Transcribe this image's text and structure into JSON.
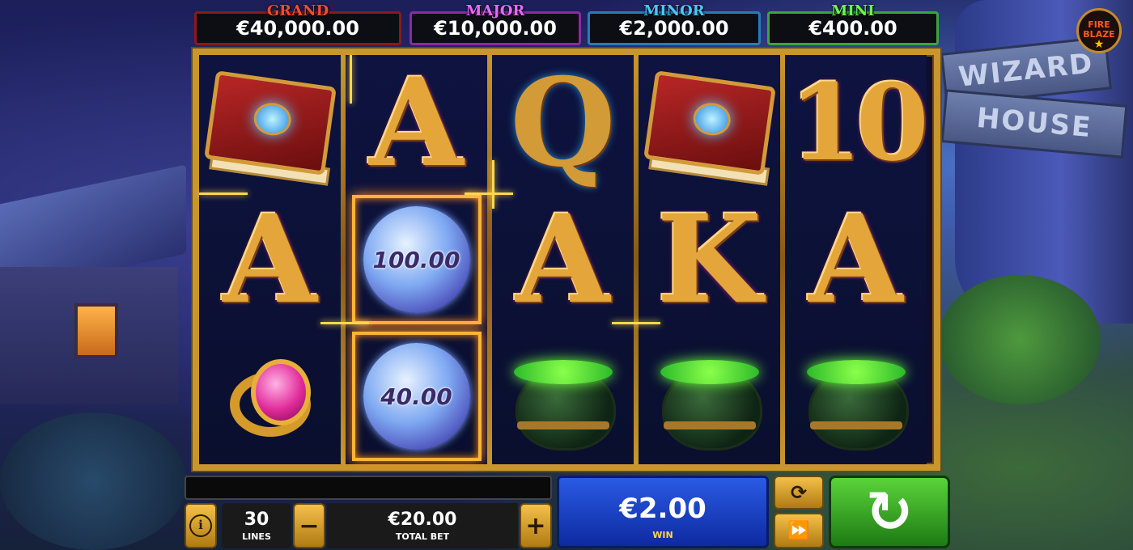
{
  "jackpots": {
    "grand": {
      "title": "GRAND",
      "value": "€40,000.00"
    },
    "major": {
      "title": "MAJOR",
      "value": "€10,000.00"
    },
    "minor": {
      "title": "MINOR",
      "value": "€2,000.00"
    },
    "mini": {
      "title": "MINI",
      "value": "€400.00"
    }
  },
  "logo": {
    "line1": "FIRE",
    "line2": "BLAZE"
  },
  "scenery": {
    "sign_top": "WIZARD",
    "sign_bottom": "HOUSE"
  },
  "reels": [
    [
      {
        "symbol": "spell-book"
      },
      {
        "symbol": "letter",
        "text": "A"
      },
      {
        "symbol": "ring"
      }
    ],
    [
      {
        "symbol": "letter",
        "text": "A"
      },
      {
        "symbol": "orb",
        "text": "100.00"
      },
      {
        "symbol": "orb",
        "text": "40.00"
      }
    ],
    [
      {
        "symbol": "letter",
        "text": "Q"
      },
      {
        "symbol": "letter",
        "text": "A"
      },
      {
        "symbol": "cauldron"
      }
    ],
    [
      {
        "symbol": "spell-book"
      },
      {
        "symbol": "letter",
        "text": "K"
      },
      {
        "symbol": "cauldron"
      }
    ],
    [
      {
        "symbol": "letter",
        "text": "10"
      },
      {
        "symbol": "letter",
        "text": "A"
      },
      {
        "symbol": "cauldron"
      }
    ]
  ],
  "controls": {
    "info_label": "i",
    "lines_value": "30",
    "lines_label": "LINES",
    "minus_label": "−",
    "plus_label": "+",
    "total_bet_value": "€20.00",
    "total_bet_label": "TOTAL BET",
    "win_value": "€2.00",
    "win_label": "WIN",
    "autoplay_icon": "autoplay-icon",
    "turbo_icon": "fast-forward-icon",
    "spin_icon": "spin-icon"
  },
  "colors": {
    "frame_gold": "#c9962e",
    "win_blue": "#1e46c8",
    "spin_green": "#3ab82a"
  }
}
